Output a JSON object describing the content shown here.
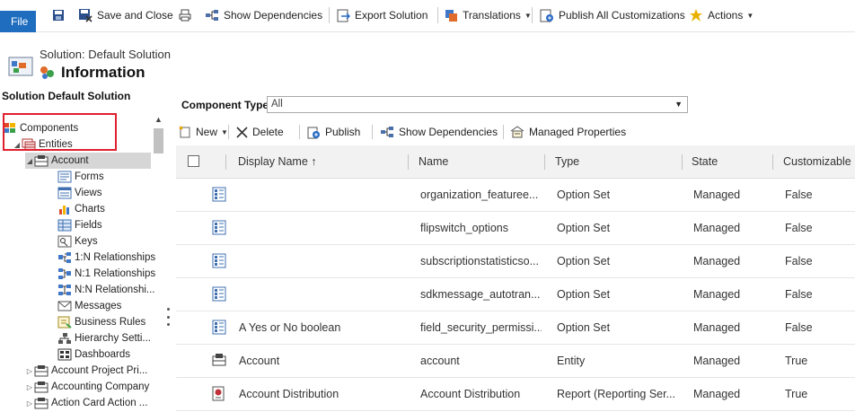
{
  "ribbon": {
    "file": "File",
    "save_close": "Save and Close",
    "show_dependencies": "Show Dependencies",
    "export_solution": "Export Solution",
    "translations": "Translations",
    "publish_all": "Publish All Customizations",
    "actions": "Actions"
  },
  "header": {
    "subtitle": "Solution: Default Solution",
    "title": "Information"
  },
  "tree": {
    "title": "Solution Default Solution",
    "nodes": [
      {
        "label": "Components",
        "icon": "components-icon"
      },
      {
        "label": "Entities",
        "icon": "entities-icon"
      },
      {
        "label": "Account",
        "icon": "entity-icon"
      },
      {
        "label": "Forms",
        "icon": "forms-icon"
      },
      {
        "label": "Views",
        "icon": "views-icon"
      },
      {
        "label": "Charts",
        "icon": "charts-icon"
      },
      {
        "label": "Fields",
        "icon": "fields-icon"
      },
      {
        "label": "Keys",
        "icon": "keys-icon"
      },
      {
        "label": "1:N Relationships",
        "icon": "relationship-icon"
      },
      {
        "label": "N:1 Relationships",
        "icon": "relationship-icon"
      },
      {
        "label": "N:N Relationshi...",
        "icon": "relationship-icon"
      },
      {
        "label": "Messages",
        "icon": "messages-icon"
      },
      {
        "label": "Business Rules",
        "icon": "business-rules-icon"
      },
      {
        "label": "Hierarchy Setti...",
        "icon": "hierarchy-icon"
      },
      {
        "label": "Dashboards",
        "icon": "dashboards-icon"
      },
      {
        "label": "Account Project Pri...",
        "icon": "entity-icon"
      },
      {
        "label": "Accounting Company",
        "icon": "entity-icon"
      },
      {
        "label": "Action Card Action ...",
        "icon": "entity-icon"
      }
    ]
  },
  "filter": {
    "label": "Component Type",
    "value": "All"
  },
  "toolbar": {
    "new": "New",
    "delete": "Delete",
    "publish": "Publish",
    "show_dependencies": "Show Dependencies",
    "managed_properties": "Managed Properties"
  },
  "grid": {
    "columns": [
      "Display Name ↑",
      "Name",
      "Type",
      "State",
      "Customizable"
    ],
    "rows": [
      {
        "display": "",
        "name": "organization_featuree...",
        "type": "Option Set",
        "state": "Managed",
        "customizable": "False",
        "icon": "option-set-icon"
      },
      {
        "display": "",
        "name": "flipswitch_options",
        "type": "Option Set",
        "state": "Managed",
        "customizable": "False",
        "icon": "option-set-icon"
      },
      {
        "display": "",
        "name": "subscriptionstatisticso...",
        "type": "Option Set",
        "state": "Managed",
        "customizable": "False",
        "icon": "option-set-icon"
      },
      {
        "display": "",
        "name": "sdkmessage_autotran...",
        "type": "Option Set",
        "state": "Managed",
        "customizable": "False",
        "icon": "option-set-icon"
      },
      {
        "display": "A Yes or No boolean",
        "name": "field_security_permissi...",
        "type": "Option Set",
        "state": "Managed",
        "customizable": "False",
        "icon": "option-set-icon"
      },
      {
        "display": "Account",
        "name": "account",
        "type": "Entity",
        "state": "Managed",
        "customizable": "True",
        "icon": "entity-icon"
      },
      {
        "display": "Account Distribution",
        "name": "Account Distribution",
        "type": "Report (Reporting Ser...",
        "state": "Managed",
        "customizable": "True",
        "icon": "report-icon"
      }
    ]
  },
  "colors": {
    "file_button": "#1f6dbf",
    "highlight_box": "#e0202e",
    "selected_node": "#d6d6d6",
    "grid_header": "#f2f2f2"
  }
}
